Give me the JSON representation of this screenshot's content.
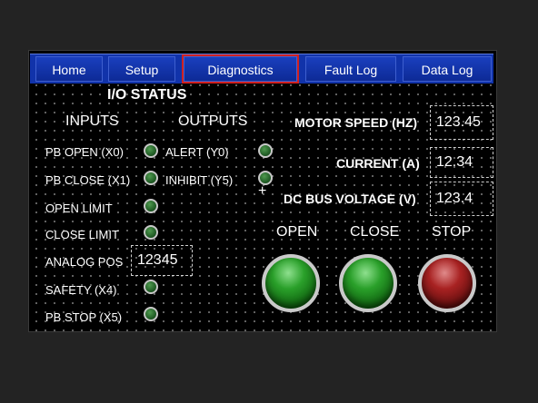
{
  "tabs": [
    {
      "label": "Home"
    },
    {
      "label": "Setup"
    },
    {
      "label": "Diagnostics",
      "active": true
    },
    {
      "label": "Fault Log"
    },
    {
      "label": "Data Log"
    }
  ],
  "io": {
    "title": "I/O STATUS",
    "inputs_header": "INPUTS",
    "outputs_header": "OUTPUTS",
    "inputs": [
      {
        "label": "PB OPEN (X0)"
      },
      {
        "label": "PB CLOSE (X1)"
      },
      {
        "label": "OPEN LIMIT"
      },
      {
        "label": "CLOSE LIMIT"
      },
      {
        "label": "SAFETY (X4)"
      },
      {
        "label": "PB STOP (X5)"
      }
    ],
    "outputs": [
      {
        "label": "ALERT (Y0)"
      },
      {
        "label": "INHIBIT (Y5)"
      }
    ],
    "analog": {
      "label": "ANALOG POS",
      "value": "12345"
    }
  },
  "readouts": {
    "motor_speed": {
      "label": "MOTOR SPEED (HZ)",
      "value": "123.45"
    },
    "current": {
      "label": "CURRENT (A)",
      "value": "12.34"
    },
    "dc_bus": {
      "label": "DC BUS VOLTAGE (V)",
      "value": "123.4"
    }
  },
  "buttons": {
    "open": {
      "label": "OPEN",
      "color": "#2aa02a"
    },
    "close": {
      "label": "CLOSE",
      "color": "#2aa02a"
    },
    "stop": {
      "label": "STOP",
      "color": "#a82222"
    }
  },
  "colors": {
    "tab_bar": "#1133aa",
    "active_outline": "#d02020",
    "indicator_on": "#2f7a33"
  }
}
